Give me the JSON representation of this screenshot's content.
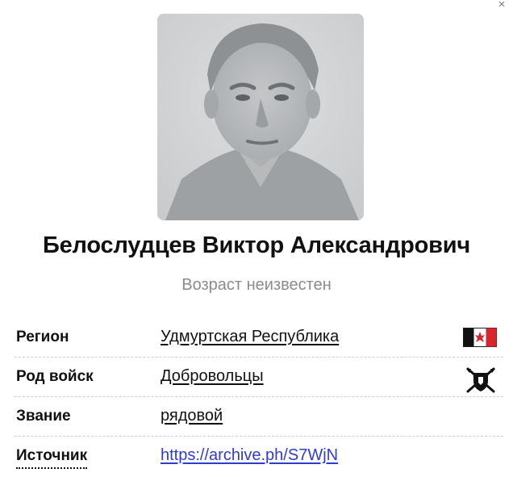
{
  "person": {
    "name": "Белослудцев Виктор Александрович",
    "age": "Возраст неизвестен"
  },
  "close_symbol": "×",
  "details": {
    "region": {
      "label": "Регион",
      "value": "Удмуртская Республика",
      "icon": "udmurtia-flag-icon"
    },
    "branch": {
      "label": "Род войск",
      "value": "Добровольцы",
      "icon": "volunteers-emblem-icon"
    },
    "rank": {
      "label": "Звание",
      "value": "рядовой"
    },
    "source": {
      "label": "Источник",
      "value": "https://archive.ph/S7WjN"
    }
  },
  "colors": {
    "link": "#2f3bd1",
    "report_badge": "#e0565a",
    "muted_text": "#8c8c8c"
  }
}
